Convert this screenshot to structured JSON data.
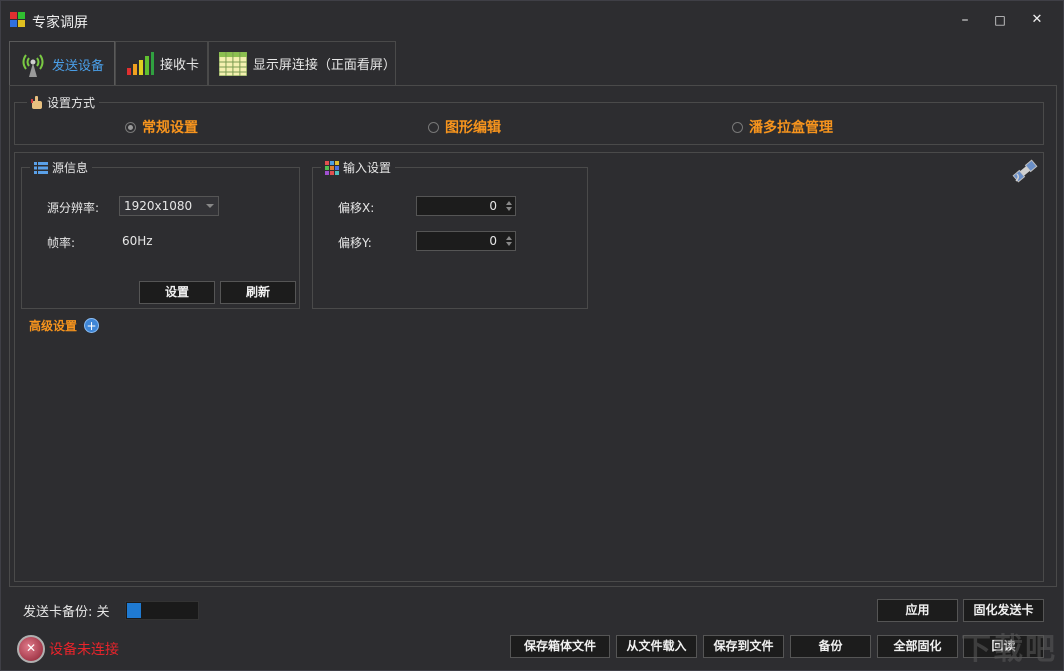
{
  "window": {
    "title": "专家调屏",
    "controls": {
      "minimize": "–",
      "maximize": "□",
      "close": "✕"
    }
  },
  "tabs": [
    {
      "label": "发送设备",
      "icon": "antenna-icon",
      "active": true
    },
    {
      "label": "接收卡",
      "icon": "signal-bars-icon",
      "active": false
    },
    {
      "label": "显示屏连接（正面看屏）",
      "icon": "grid-table-icon",
      "active": false
    }
  ],
  "mode": {
    "legend": "设置方式",
    "options": [
      {
        "label": "常规设置",
        "checked": true
      },
      {
        "label": "图形编辑",
        "checked": false
      },
      {
        "label": "潘多拉盒管理",
        "checked": false
      }
    ]
  },
  "source_info": {
    "legend": "源信息",
    "resolution_label": "源分辨率:",
    "resolution_value": "1920x1080",
    "framerate_label": "帧率:",
    "framerate_value": "60Hz",
    "set_button": "设置",
    "refresh_button": "刷新"
  },
  "input_settings": {
    "legend": "输入设置",
    "offset_x_label": "偏移X:",
    "offset_x_value": "0",
    "offset_y_label": "偏移Y:",
    "offset_y_value": "0"
  },
  "advanced": {
    "label": "高级设置"
  },
  "backup": {
    "label": "发送卡备份: 关",
    "on": false
  },
  "buttons": {
    "apply": "应用",
    "solidify_sender": "固化发送卡",
    "save_cabinet": "保存箱体文件",
    "load_from_file": "从文件载入",
    "save_to_file": "保存到文件",
    "backup": "备份",
    "solidify_all": "全部固化",
    "readback": "回读"
  },
  "status": {
    "label": "设备未连接"
  },
  "watermark": {
    "text": "下载吧"
  },
  "colors": {
    "accent_orange": "#f7941d",
    "tab_active_blue": "#4a9fe8",
    "status_red": "#e8242b",
    "toggle_blue": "#1f7ad1"
  }
}
